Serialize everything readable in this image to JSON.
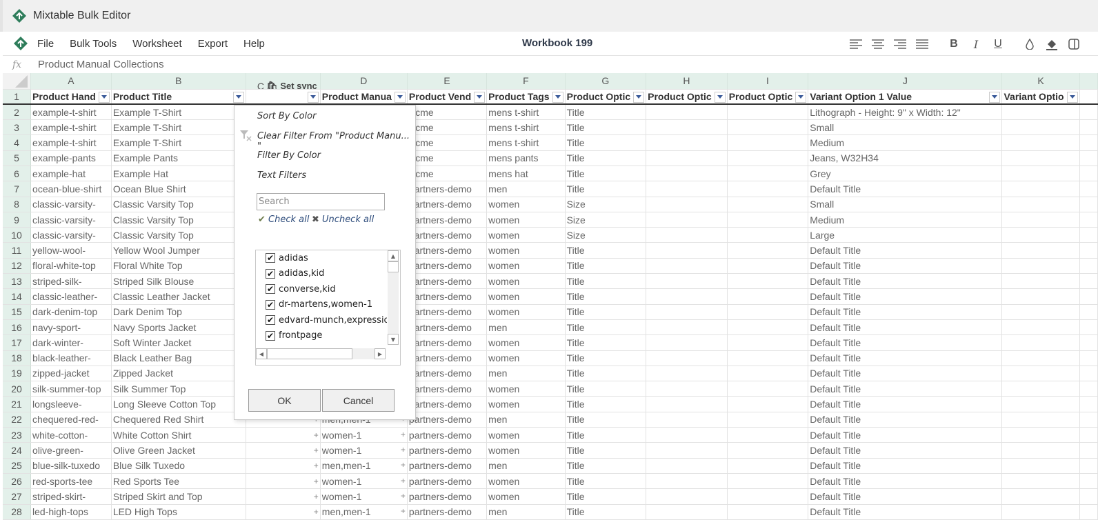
{
  "app": {
    "title": "Mixtable Bulk Editor",
    "workbook": "Workbook 199"
  },
  "menu": [
    "File",
    "Bulk Tools",
    "Worksheet",
    "Export",
    "Help"
  ],
  "toolbar": [
    "align-left",
    "align-center",
    "align-right",
    "align-justify",
    "bold",
    "italic",
    "underline",
    "text-color",
    "fill-color",
    "border"
  ],
  "formula": {
    "label": "fx",
    "value": "Product Manual Collections"
  },
  "columns": {
    "letters": [
      "A",
      "B",
      "C",
      "D",
      "E",
      "F",
      "G",
      "H",
      "I",
      "J",
      "K"
    ],
    "sync_label": "Set sync",
    "headers": [
      "Product Hand",
      "Product Title",
      "",
      "Product Manua",
      "Product Vend",
      "Product Tags",
      "Product Optic",
      "Product Optic",
      "Product Optic",
      "Variant Option 1 Value",
      "Variant Optio"
    ]
  },
  "rows": [
    {
      "n": "2",
      "a": "example-t-shirt",
      "b": "Example T-Shirt",
      "d": "",
      "e": "Acme",
      "f": "mens t-shirt",
      "g": "Title",
      "j": "Lithograph - Height: 9\" x Width: 12\""
    },
    {
      "n": "3",
      "a": "example-t-shirt",
      "b": "Example T-Shirt",
      "d": "",
      "e": "Acme",
      "f": "mens t-shirt",
      "g": "Title",
      "j": "Small"
    },
    {
      "n": "4",
      "a": "example-t-shirt",
      "b": "Example T-Shirt",
      "d": "",
      "e": "Acme",
      "f": "mens t-shirt",
      "g": "Title",
      "j": "Medium"
    },
    {
      "n": "5",
      "a": "example-pants",
      "b": "Example Pants",
      "d": "",
      "e": "Acme",
      "f": "mens pants",
      "g": "Title",
      "j": "Jeans, W32H34"
    },
    {
      "n": "6",
      "a": "example-hat",
      "b": "Example Hat",
      "d": "",
      "e": "Acme",
      "f": "mens hat",
      "g": "Title",
      "j": "Grey"
    },
    {
      "n": "7",
      "a": "ocean-blue-shirt",
      "b": "Ocean Blue Shirt",
      "d": "",
      "e": "partners-demo",
      "f": "men",
      "g": "Title",
      "j": "Default Title"
    },
    {
      "n": "8",
      "a": "classic-varsity-",
      "b": "Classic Varsity Top",
      "d": "",
      "e": "partners-demo",
      "f": "women",
      "g": "Size",
      "j": "Small"
    },
    {
      "n": "9",
      "a": "classic-varsity-",
      "b": "Classic Varsity Top",
      "d": "",
      "e": "partners-demo",
      "f": "women",
      "g": "Size",
      "j": "Medium"
    },
    {
      "n": "10",
      "a": "classic-varsity-",
      "b": "Classic Varsity Top",
      "d": "",
      "e": "partners-demo",
      "f": "women",
      "g": "Size",
      "j": "Large"
    },
    {
      "n": "11",
      "a": "yellow-wool-",
      "b": "Yellow Wool Jumper",
      "d": "",
      "e": "partners-demo",
      "f": "women",
      "g": "Title",
      "j": "Default Title"
    },
    {
      "n": "12",
      "a": "floral-white-top",
      "b": "Floral White Top",
      "d": "",
      "e": "partners-demo",
      "f": "women",
      "g": "Title",
      "j": "Default Title"
    },
    {
      "n": "13",
      "a": "striped-silk-",
      "b": "Striped Silk Blouse",
      "d": "",
      "e": "partners-demo",
      "f": "women",
      "g": "Title",
      "j": "Default Title"
    },
    {
      "n": "14",
      "a": "classic-leather-",
      "b": "Classic Leather Jacket",
      "d": "",
      "e": "partners-demo",
      "f": "women",
      "g": "Title",
      "j": "Default Title"
    },
    {
      "n": "15",
      "a": "dark-denim-top",
      "b": "Dark Denim Top",
      "d": "",
      "e": "partners-demo",
      "f": "women",
      "g": "Title",
      "j": "Default Title"
    },
    {
      "n": "16",
      "a": "navy-sport-",
      "b": "Navy Sports Jacket",
      "d": "",
      "e": "partners-demo",
      "f": "men",
      "g": "Title",
      "j": "Default Title"
    },
    {
      "n": "17",
      "a": "dark-winter-",
      "b": "Soft Winter Jacket",
      "d": "",
      "e": "partners-demo",
      "f": "women",
      "g": "Title",
      "j": "Default Title"
    },
    {
      "n": "18",
      "a": "black-leather-",
      "b": "Black Leather Bag",
      "d": "",
      "e": "partners-demo",
      "f": "women",
      "g": "Title",
      "j": "Default Title"
    },
    {
      "n": "19",
      "a": "zipped-jacket",
      "b": "Zipped Jacket",
      "d": "",
      "e": "partners-demo",
      "f": "men",
      "g": "Title",
      "j": "Default Title"
    },
    {
      "n": "20",
      "a": "silk-summer-top",
      "b": "Silk Summer Top",
      "d": "",
      "e": "partners-demo",
      "f": "women",
      "g": "Title",
      "j": "Default Title"
    },
    {
      "n": "21",
      "a": "longsleeve-",
      "b": "Long Sleeve Cotton Top",
      "d": "",
      "e": "partners-demo",
      "f": "women",
      "g": "Title",
      "j": "Default Title"
    },
    {
      "n": "22",
      "a": "chequered-red-",
      "b": "Chequered Red Shirt",
      "d": "men,men-1",
      "e": "partners-demo",
      "f": "men",
      "g": "Title",
      "j": "Default Title"
    },
    {
      "n": "23",
      "a": "white-cotton-",
      "b": "White Cotton Shirt",
      "d": "women-1",
      "e": "partners-demo",
      "f": "women",
      "g": "Title",
      "j": "Default Title"
    },
    {
      "n": "24",
      "a": "olive-green-",
      "b": "Olive Green Jacket",
      "d": "women-1",
      "e": "partners-demo",
      "f": "women",
      "g": "Title",
      "j": "Default Title"
    },
    {
      "n": "25",
      "a": "blue-silk-tuxedo",
      "b": "Blue Silk Tuxedo",
      "d": "men,men-1",
      "e": "partners-demo",
      "f": "men",
      "g": "Title",
      "j": "Default Title"
    },
    {
      "n": "26",
      "a": "red-sports-tee",
      "b": "Red Sports Tee",
      "d": "women-1",
      "e": "partners-demo",
      "f": "women",
      "g": "Title",
      "j": "Default Title"
    },
    {
      "n": "27",
      "a": "striped-skirt-",
      "b": "Striped Skirt and Top",
      "d": "women-1",
      "e": "partners-demo",
      "f": "women",
      "g": "Title",
      "j": "Default Title"
    },
    {
      "n": "28",
      "a": "led-high-tops",
      "b": "LED High Tops",
      "d": "men,men-1",
      "e": "partners-demo",
      "f": "men",
      "g": "Title",
      "j": "Default Title"
    }
  ],
  "filter_dropdown": {
    "sort_by_color": "Sort By Color",
    "clear_filter": "Clear Filter From \"Product Manu... \"",
    "filter_by_color": "Filter By Color",
    "text_filters": "Text Filters",
    "search_placeholder": "Search",
    "check_all": "Check all",
    "uncheck_all": "Uncheck all",
    "options": [
      {
        "label": "adidas",
        "checked": true
      },
      {
        "label": "adidas,kid",
        "checked": true
      },
      {
        "label": "converse,kid",
        "checked": true
      },
      {
        "label": "dr-martens,women-1",
        "checked": true
      },
      {
        "label": "edvard-munch,expressionism",
        "checked": true
      },
      {
        "label": "frontpage",
        "checked": true
      }
    ],
    "ok": "OK",
    "cancel": "Cancel"
  },
  "colors": {
    "accent": "#2e7d5b",
    "header_bg": "#e3f0ea"
  }
}
